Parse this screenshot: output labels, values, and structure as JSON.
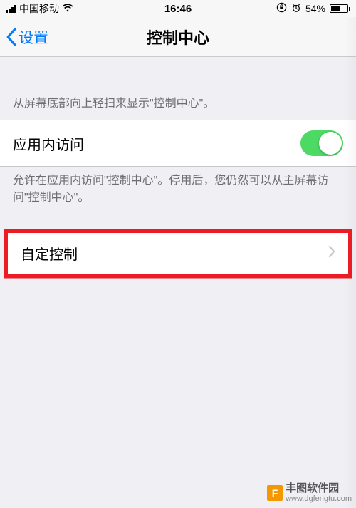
{
  "status": {
    "carrier": "中国移动",
    "time": "16:46",
    "battery_pct_text": "54%",
    "battery_pct": 54
  },
  "nav": {
    "back_label": "设置",
    "title": "控制中心"
  },
  "section1": {
    "help_text": "从屏幕底部向上轻扫来显示\"控制中心\"。"
  },
  "row_in_app": {
    "label": "应用内访问",
    "switch_on": true,
    "footer_text": "允许在应用内访问\"控制中心\"。停用后，您仍然可以从主屏幕访问\"控制中心\"。"
  },
  "row_customize": {
    "label": "自定控制"
  },
  "watermark": {
    "logo_letter": "F",
    "title": "丰图软件园",
    "url": "www.dgfengtu.com"
  }
}
